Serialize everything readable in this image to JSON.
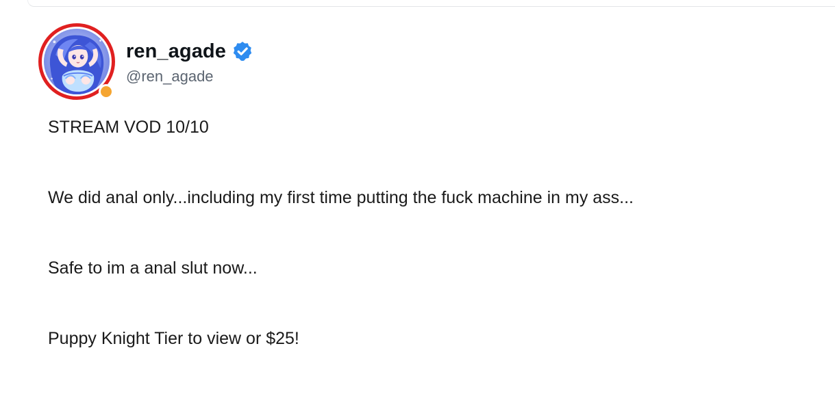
{
  "post": {
    "author": {
      "display_name": "ren_agade",
      "handle": "@ren_agade",
      "verified": true,
      "avatar_icon": "anime-avatar-icon",
      "status": "away",
      "ring_color": "#e02020",
      "status_color": "#f5a531"
    },
    "body_lines": [
      "STREAM VOD 10/10",
      "We did anal only...including my first time putting the fuck machine in my ass...",
      "Safe to im a anal slut now...",
      "Puppy Knight Tier to view or $25!"
    ]
  },
  "colors": {
    "verified_badge": "#2e8cf0",
    "handle_text": "#5b6470",
    "body_text": "#1a1a1a"
  }
}
